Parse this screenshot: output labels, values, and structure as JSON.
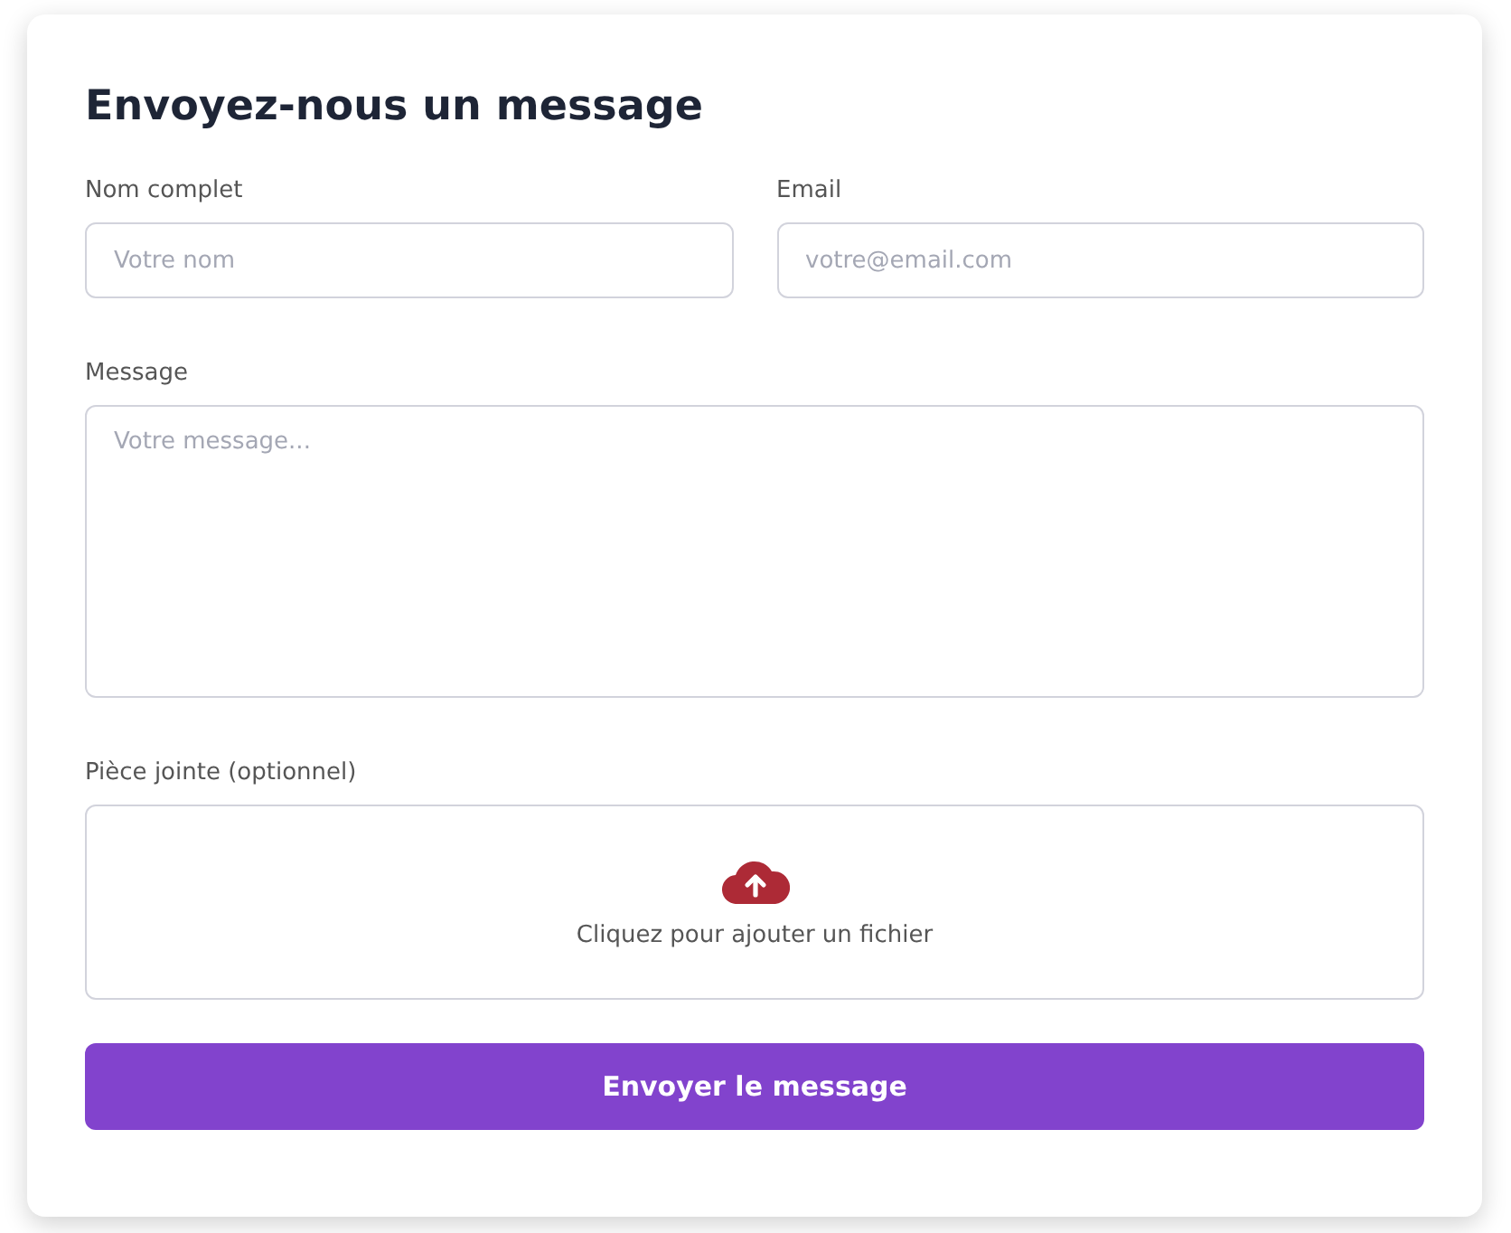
{
  "title": "Envoyez-nous un message",
  "fields": [
    {
      "label": "Nom complet",
      "placeholder": "Votre nom"
    },
    {
      "label": "Email",
      "placeholder": "votre@email.com"
    }
  ],
  "message": {
    "label": "Message",
    "placeholder": "Votre message..."
  },
  "attachment": {
    "label": "Pièce jointe (optionnel)",
    "hint": "Cliquez pour ajouter un fichier"
  },
  "submit": "Envoyer le message"
}
